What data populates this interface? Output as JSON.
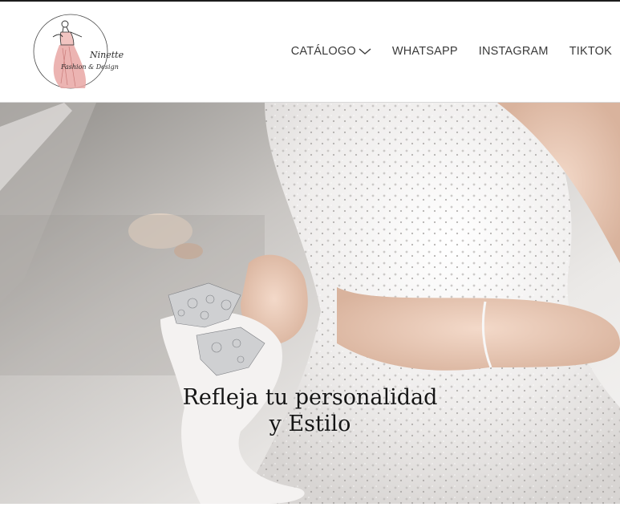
{
  "brand": {
    "name": "Ninette",
    "tagline": "Fashion & Design"
  },
  "nav": {
    "items": [
      {
        "label": "CATÁLOGO",
        "has_dropdown": true
      },
      {
        "label": "WHATSAPP"
      },
      {
        "label": "INSTAGRAM"
      },
      {
        "label": "TIKTOK"
      }
    ]
  },
  "hero": {
    "heading_line1": "Refleja tu personalidad",
    "heading_line2": "y Estilo"
  },
  "colors": {
    "logo_pink": "#e9a7a4",
    "logo_ink": "#2b2b2b",
    "nav_text": "#3a3a3a",
    "heading_text": "#151515"
  }
}
